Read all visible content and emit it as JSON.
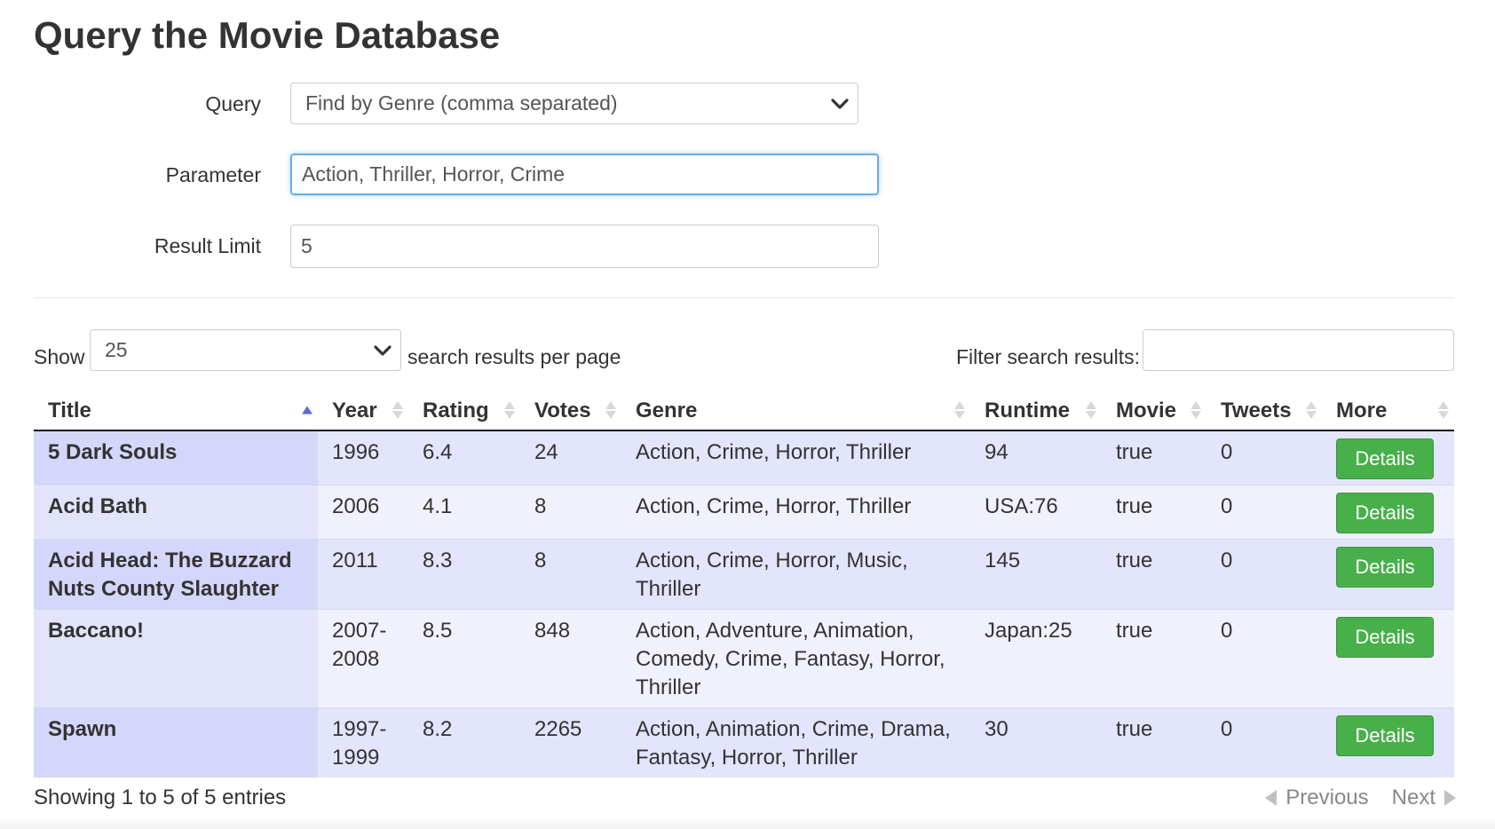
{
  "page": {
    "title": "Query the Movie Database"
  },
  "form": {
    "query_label": "Query",
    "query_value": "Find by Genre (comma separated)",
    "parameter_label": "Parameter",
    "parameter_value": "Action, Thriller, Horror, Crime",
    "limit_label": "Result Limit",
    "limit_value": "5"
  },
  "table_controls": {
    "show_label": "Show",
    "page_length": "25",
    "per_page_label": "search results per page",
    "filter_label": "Filter search results:",
    "filter_value": ""
  },
  "table": {
    "columns": [
      "Title",
      "Year",
      "Rating",
      "Votes",
      "Genre",
      "Runtime",
      "Movie",
      "Tweets",
      "More"
    ],
    "sorted_column": "Title",
    "sort_direction": "ascending",
    "rows": [
      {
        "title": "5 Dark Souls",
        "year": "1996",
        "rating": "6.4",
        "votes": "24",
        "genre": "Action, Crime, Horror, Thriller",
        "runtime": "94",
        "movie": "true",
        "tweets": "0",
        "more": "Details"
      },
      {
        "title": "Acid Bath",
        "year": "2006",
        "rating": "4.1",
        "votes": "8",
        "genre": "Action, Crime, Horror, Thriller",
        "runtime": "USA:76",
        "movie": "true",
        "tweets": "0",
        "more": "Details"
      },
      {
        "title": "Acid Head: The Buzzard Nuts County Slaughter",
        "year": "2011",
        "rating": "8.3",
        "votes": "8",
        "genre": "Action, Crime, Horror, Music, Thriller",
        "runtime": "145",
        "movie": "true",
        "tweets": "0",
        "more": "Details"
      },
      {
        "title": "Baccano!",
        "year": "2007-2008",
        "rating": "8.5",
        "votes": "848",
        "genre": "Action, Adventure, Animation, Comedy, Crime, Fantasy, Horror, Thriller",
        "runtime": "Japan:25",
        "movie": "true",
        "tweets": "0",
        "more": "Details"
      },
      {
        "title": "Spawn",
        "year": "1997-1999",
        "rating": "8.2",
        "votes": "2265",
        "genre": "Action, Animation, Crime, Drama, Fantasy, Horror, Thriller",
        "runtime": "30",
        "movie": "true",
        "tweets": "0",
        "more": "Details"
      }
    ]
  },
  "footer": {
    "info": "Showing 1 to 5 of 5 entries",
    "previous_label": "Previous",
    "next_label": "Next"
  },
  "colors": {
    "button_green": "#48b04a",
    "row_odd": "#e2e5fc",
    "row_even": "#f0f1fd",
    "sort_active": "#5a6bd8",
    "focus_border": "#66afe9"
  },
  "icons": {
    "select_arrow": "chevron-down-icon",
    "sort_indicator": "sort-icon",
    "previous": "triangle-left-icon",
    "next": "triangle-right-icon"
  }
}
